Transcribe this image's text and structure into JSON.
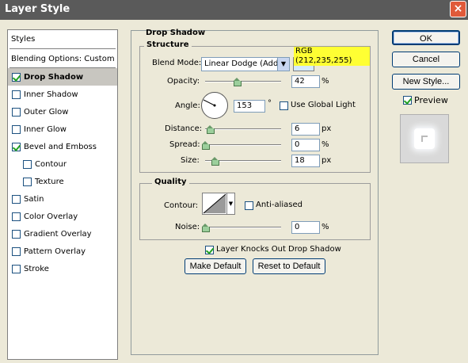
{
  "window": {
    "title": "Layer Style",
    "close_glyph": "×"
  },
  "left_panel": {
    "styles_label": "Styles",
    "blending_label": "Blending Options: Custom",
    "items": [
      {
        "label": "Drop Shadow",
        "checked": true
      },
      {
        "label": "Inner Shadow",
        "checked": false
      },
      {
        "label": "Outer Glow",
        "checked": false
      },
      {
        "label": "Inner Glow",
        "checked": false
      },
      {
        "label": "Bevel and Emboss",
        "checked": true
      },
      {
        "label": "Contour",
        "checked": false
      },
      {
        "label": "Texture",
        "checked": false
      },
      {
        "label": "Satin",
        "checked": false
      },
      {
        "label": "Color Overlay",
        "checked": false
      },
      {
        "label": "Gradient Overlay",
        "checked": false
      },
      {
        "label": "Pattern Overlay",
        "checked": false
      },
      {
        "label": "Stroke",
        "checked": false
      }
    ]
  },
  "drop_shadow": {
    "title": "Drop Shadow",
    "structure": {
      "title": "Structure",
      "blend_mode_label": "Blend Mode:",
      "blend_mode_value": "Linear Dodge (Add)",
      "swatch_color": "#d4ebff",
      "tooltip": "RGB (212,235,255)",
      "opacity_label": "Opacity:",
      "opacity_value": "42",
      "opacity_unit": "%",
      "angle_label": "Angle:",
      "angle_value": "153",
      "angle_unit": "°",
      "use_global_light": "Use Global Light",
      "distance_label": "Distance:",
      "distance_value": "6",
      "distance_unit": "px",
      "spread_label": "Spread:",
      "spread_value": "0",
      "spread_unit": "%",
      "size_label": "Size:",
      "size_value": "18",
      "size_unit": "px"
    },
    "quality": {
      "title": "Quality",
      "contour_label": "Contour:",
      "anti_aliased": "Anti-aliased",
      "noise_label": "Noise:",
      "noise_value": "0",
      "noise_unit": "%"
    },
    "knockout_label": "Layer Knocks Out Drop Shadow",
    "make_default": "Make Default",
    "reset_default": "Reset to Default"
  },
  "buttons": {
    "ok": "OK",
    "cancel": "Cancel",
    "new_style": "New Style...",
    "preview": "Preview"
  }
}
